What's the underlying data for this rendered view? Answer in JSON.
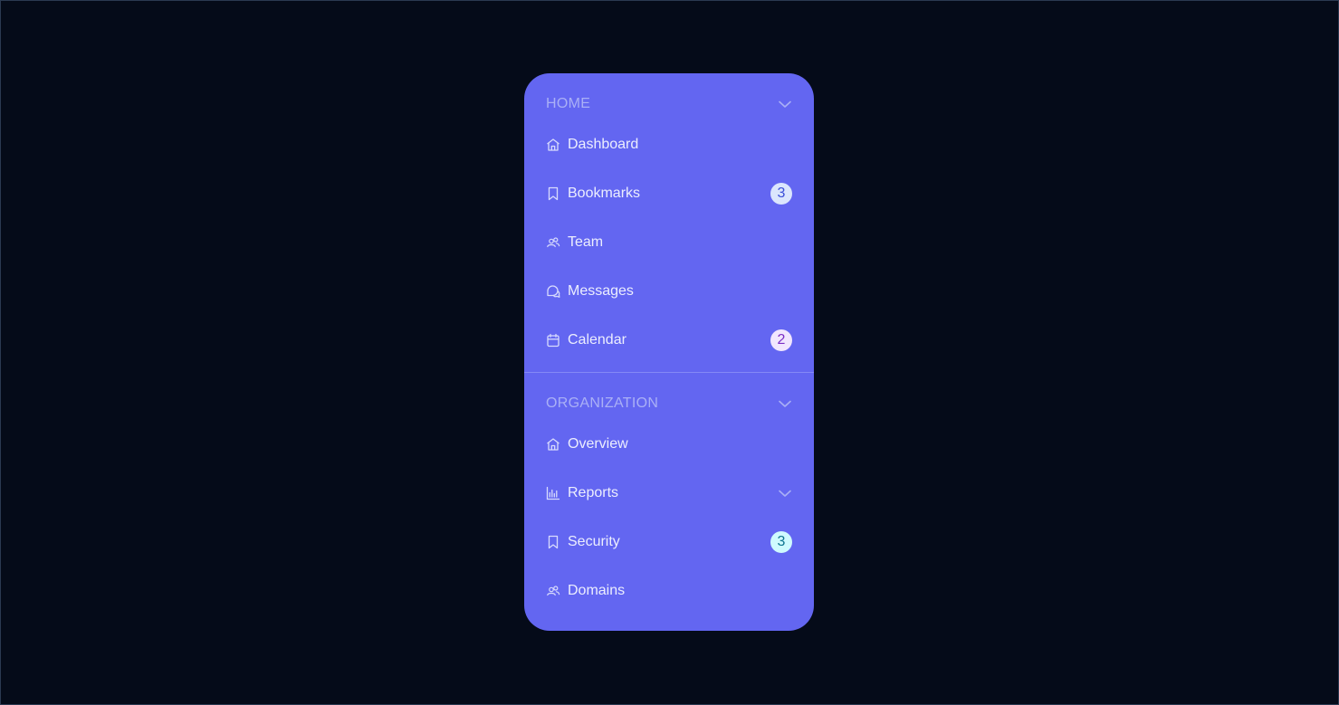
{
  "sidebar": {
    "sections": [
      {
        "title": "HOME",
        "items": [
          {
            "label": "Dashboard",
            "icon": "home-icon"
          },
          {
            "label": "Bookmarks",
            "icon": "bookmark-icon",
            "badge": "3"
          },
          {
            "label": "Team",
            "icon": "users-icon"
          },
          {
            "label": "Messages",
            "icon": "chat-icon"
          },
          {
            "label": "Calendar",
            "icon": "calendar-icon",
            "badge": "2"
          }
        ]
      },
      {
        "title": "ORGANIZATION",
        "items": [
          {
            "label": "Overview",
            "icon": "home-icon"
          },
          {
            "label": "Reports",
            "icon": "bar-chart-icon"
          },
          {
            "label": "Security",
            "icon": "bookmark-icon",
            "badge": "3"
          },
          {
            "label": "Domains",
            "icon": "users-icon"
          }
        ]
      }
    ]
  },
  "colors": {
    "background": "#050b19",
    "panel": "#6366f1",
    "badge_blue_bg": "#dbe6fd",
    "badge_blue_text": "#3b4fd8",
    "badge_purple_bg": "#f1e6fe",
    "badge_purple_text": "#7b2ec4",
    "badge_cyan_bg": "#cffafe",
    "badge_cyan_text": "#0e7490"
  }
}
